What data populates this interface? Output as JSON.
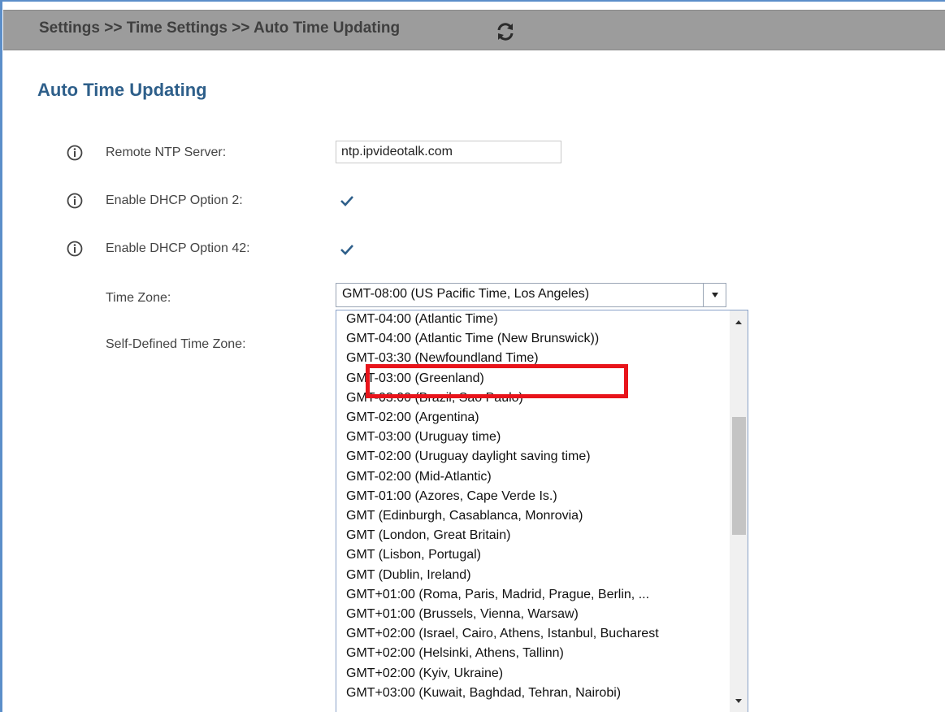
{
  "header": {
    "breadcrumb": "Settings >> Time Settings >> Auto Time Updating",
    "refresh_icon": "refresh-icon"
  },
  "page": {
    "title": "Auto Time Updating"
  },
  "form": {
    "ntp_label": "Remote NTP Server:",
    "ntp_value": "ntp.ipvideotalk.com",
    "dhcp2_label": "Enable DHCP Option 2:",
    "dhcp2_checked": true,
    "dhcp42_label": "Enable DHCP Option 42:",
    "dhcp42_checked": true,
    "timezone_label": "Time Zone:",
    "timezone_value": "GMT-08:00 (US Pacific Time, Los Angeles)",
    "self_defined_label": "Self-Defined Time Zone:"
  },
  "dropdown": {
    "options": [
      "GMT-04:00 (Atlantic Time)",
      "GMT-04:00 (Atlantic Time (New Brunswick))",
      "GMT-03:30 (Newfoundland Time)",
      "GMT-03:00 (Greenland)",
      "GMT-03:00 (Brazil, Sao Paulo)",
      "GMT-02:00 (Argentina)",
      "GMT-03:00 (Uruguay time)",
      "GMT-02:00 (Uruguay daylight saving time)",
      "GMT-02:00 (Mid-Atlantic)",
      "GMT-01:00 (Azores, Cape Verde Is.)",
      "GMT (Edinburgh, Casablanca, Monrovia)",
      "GMT (London, Great Britain)",
      "GMT (Lisbon, Portugal)",
      "GMT (Dublin, Ireland)",
      "GMT+01:00 (Roma, Paris, Madrid, Prague, Berlin, ...",
      "GMT+01:00 (Brussels, Vienna, Warsaw)",
      "GMT+02:00 (Israel, Cairo, Athens, Istanbul, Bucharest",
      "GMT+02:00 (Helsinki, Athens, Tallinn)",
      "GMT+02:00 (Kyiv, Ukraine)",
      "GMT+03:00 (Kuwait, Baghdad, Tehran, Nairobi)"
    ],
    "highlighted_option": "GMT-03:00 (Greenland)"
  },
  "colors": {
    "title": "#2e5f8a",
    "header_bg": "#9c9c9c",
    "highlight": "#e8141b",
    "check": "#2e5f8a"
  }
}
